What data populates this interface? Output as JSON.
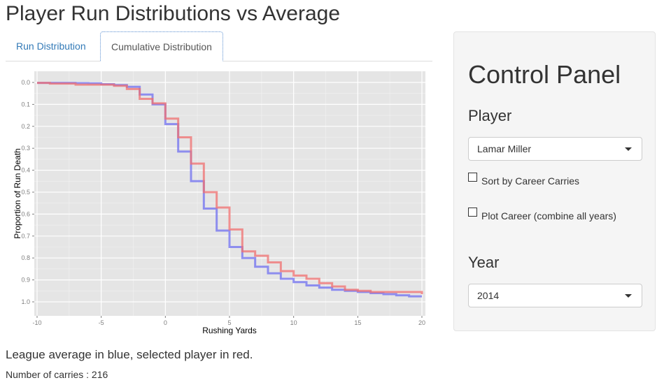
{
  "page_title": "Player Run Distributions vs Average",
  "tabs": [
    {
      "label": "Run Distribution",
      "active": false
    },
    {
      "label": "Cumulative Distribution",
      "active": true
    }
  ],
  "caption": "League average in blue, selected player in red.",
  "carries_text": "Number of carries : 216",
  "control_panel": {
    "title": "Control Panel",
    "player_label": "Player",
    "player_value": "Lamar Miller",
    "sort_checkbox": {
      "label": "Sort by Career Carries",
      "checked": false
    },
    "career_checkbox": {
      "label": "Plot Career (combine all years)",
      "checked": false
    },
    "year_label": "Year",
    "year_value": "2014"
  },
  "chart_data": {
    "type": "line",
    "step": true,
    "title": "",
    "xlabel": "Rushing Yards",
    "ylabel": "Proportion of Run Death",
    "xlim": [
      -10,
      20
    ],
    "ylim": [
      0.0,
      1.0
    ],
    "y_reversed": true,
    "x_ticks": [
      -10,
      -5,
      0,
      5,
      10,
      15,
      20
    ],
    "y_ticks": [
      0.0,
      0.1,
      0.2,
      0.3,
      0.4,
      0.5,
      0.6,
      0.7,
      0.8,
      0.9,
      1.0
    ],
    "x_tick_labels": [
      "-10",
      "-5",
      "0",
      "5",
      "10",
      "15",
      "20"
    ],
    "y_tick_labels": [
      "0.0",
      "0.1",
      "0.2",
      "0.3",
      "0.4",
      "0.5",
      "0.6",
      "0.7",
      "0.8",
      "0.9",
      "1.0"
    ],
    "grid": true,
    "x": [
      -10,
      -9,
      -8,
      -7,
      -6,
      -5,
      -4,
      -3,
      -2,
      -1,
      0,
      1,
      2,
      3,
      4,
      5,
      6,
      7,
      8,
      9,
      10,
      11,
      12,
      13,
      14,
      15,
      16,
      17,
      18,
      19,
      20
    ],
    "series": [
      {
        "name": "League average",
        "color": "#6f6ff0",
        "values": [
          0.002,
          0.002,
          0.002,
          0.003,
          0.004,
          0.008,
          0.012,
          0.02,
          0.055,
          0.1,
          0.19,
          0.315,
          0.45,
          0.575,
          0.675,
          0.75,
          0.8,
          0.84,
          0.87,
          0.895,
          0.91,
          0.925,
          0.935,
          0.945,
          0.95,
          0.955,
          0.96,
          0.965,
          0.97,
          0.975,
          0.975
        ]
      },
      {
        "name": "Selected player",
        "color": "#f06f6f",
        "values": [
          0.002,
          0.005,
          0.005,
          0.01,
          0.01,
          0.01,
          0.015,
          0.03,
          0.075,
          0.095,
          0.165,
          0.25,
          0.37,
          0.5,
          0.57,
          0.67,
          0.77,
          0.79,
          0.82,
          0.86,
          0.88,
          0.895,
          0.915,
          0.93,
          0.945,
          0.95,
          0.955,
          0.955,
          0.955,
          0.955,
          0.965
        ]
      }
    ]
  }
}
